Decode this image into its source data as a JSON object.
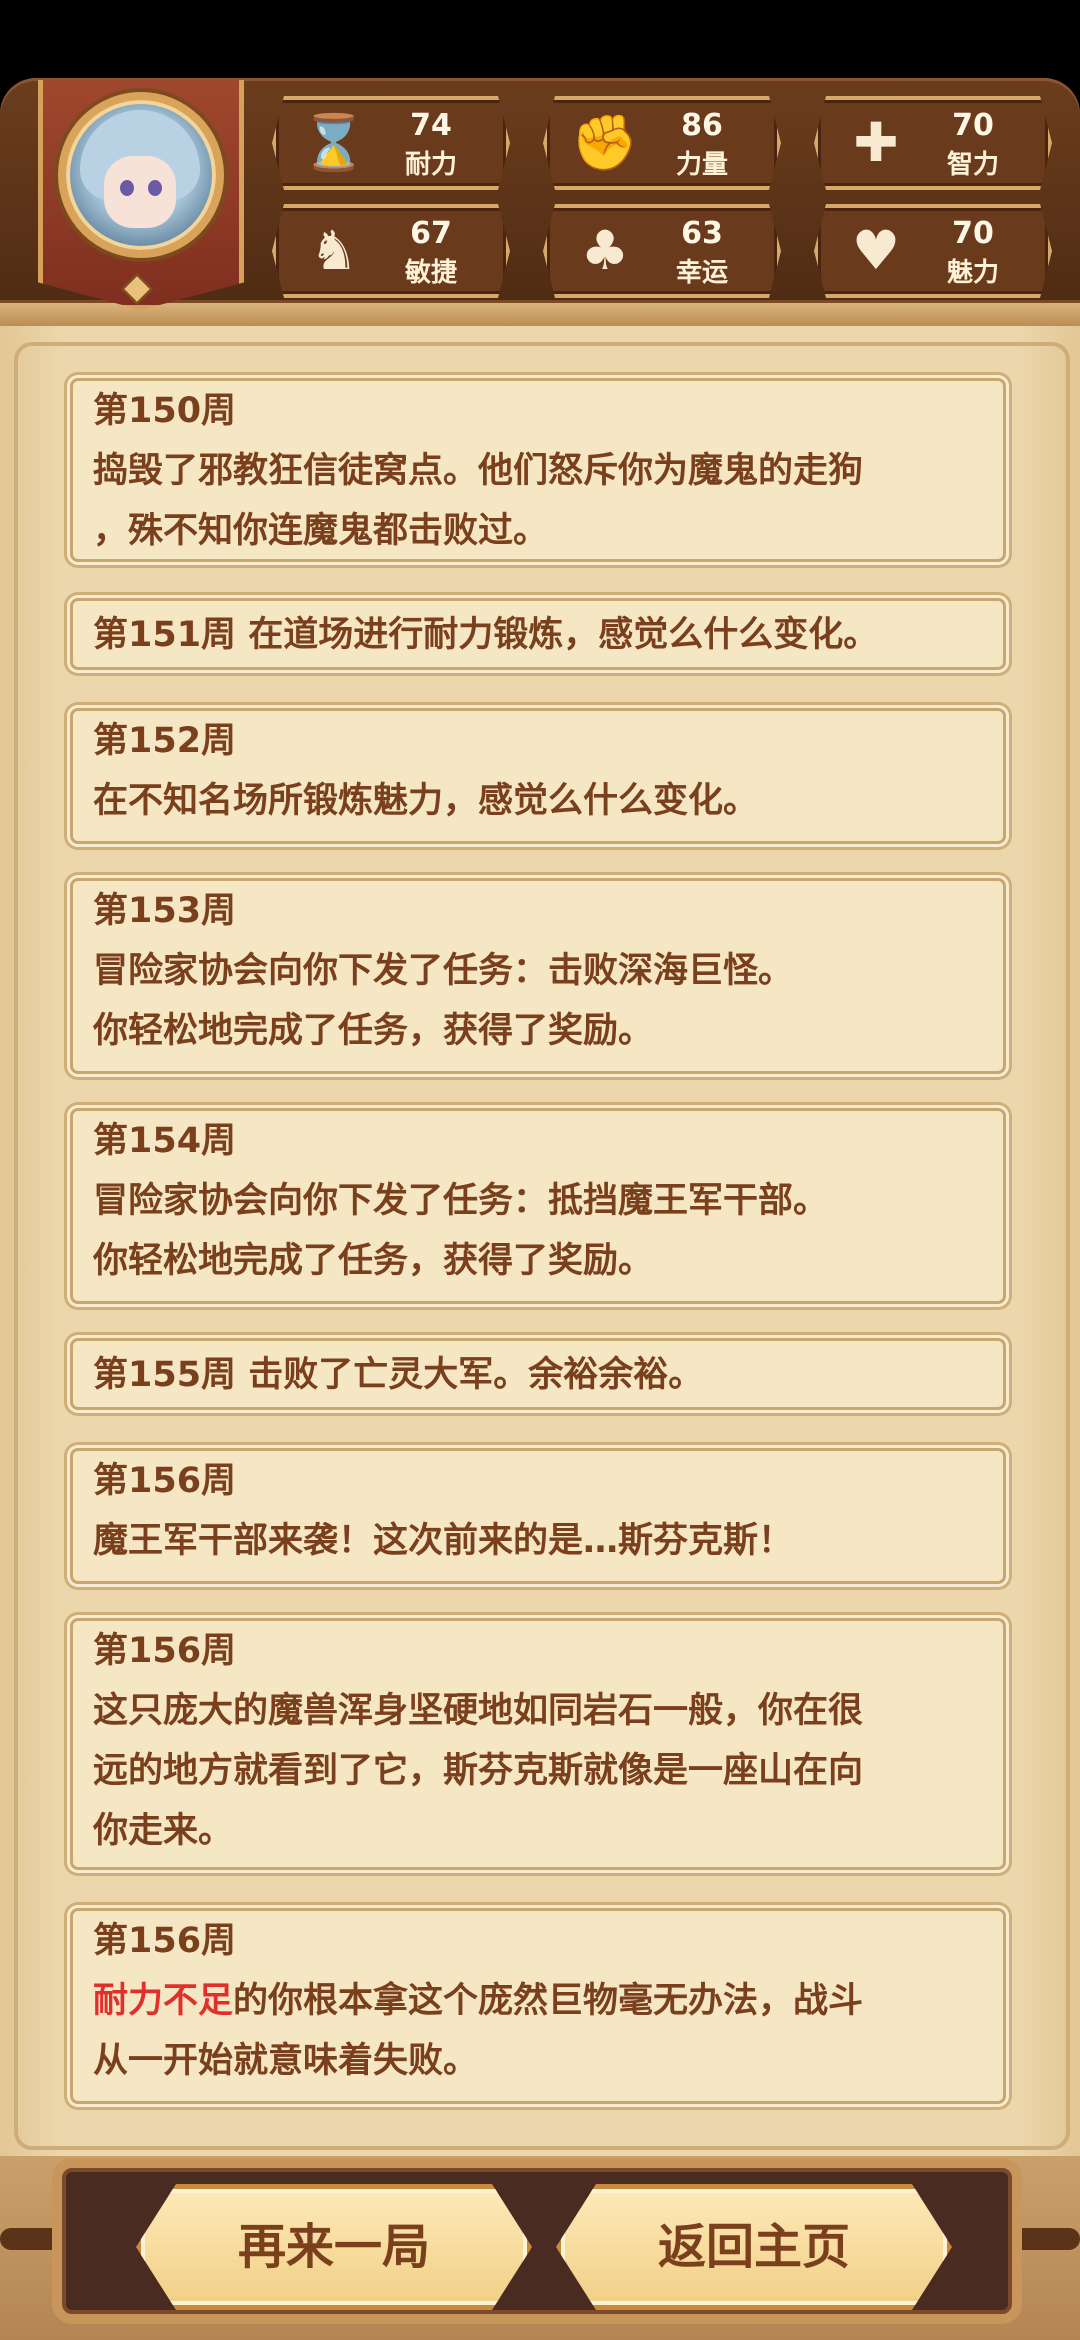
{
  "stats": [
    {
      "icon": "hourglass-icon",
      "value": "74",
      "label": "耐力"
    },
    {
      "icon": "strength-arm-icon",
      "value": "86",
      "label": "力量"
    },
    {
      "icon": "puzzle-icon",
      "value": "70",
      "label": "智力"
    },
    {
      "icon": "boot-icon",
      "value": "67",
      "label": "敏捷"
    },
    {
      "icon": "clover-icon",
      "value": "63",
      "label": "幸运"
    },
    {
      "icon": "heart-plus-icon",
      "value": "70",
      "label": "魅力"
    }
  ],
  "log": [
    {
      "week": "第150周",
      "lines": [
        "捣毁了邪教狂信徒窝点。他们怒斥你为魔鬼的走狗",
        "，殊不知你连魔鬼都击败过。"
      ]
    },
    {
      "inline": "第151周 在道场进行耐力锻炼，感觉么什么变化。"
    },
    {
      "week": "第152周",
      "lines": [
        "在不知名场所锻炼魅力，感觉么什么变化。"
      ]
    },
    {
      "week": "第153周",
      "lines": [
        "冒险家协会向你下发了任务：击败深海巨怪。",
        "你轻松地完成了任务，获得了奖励。"
      ]
    },
    {
      "week": "第154周",
      "lines": [
        "冒险家协会向你下发了任务：抵挡魔王军干部。",
        "你轻松地完成了任务，获得了奖励。"
      ]
    },
    {
      "inline": "第155周 击败了亡灵大军。余裕余裕。"
    },
    {
      "week": "第156周",
      "lines": [
        "魔王军干部来袭！这次前来的是…斯芬克斯！"
      ]
    },
    {
      "week": "第156周",
      "lines": [
        "这只庞大的魔兽浑身坚硬地如同岩石一般，你在很",
        "远的地方就看到了它，斯芬克斯就像是一座山在向",
        "你走来。"
      ]
    },
    {
      "week": "第156周",
      "highlight": "耐力不足",
      "line1_rest": "的你根本拿这个庞然巨物毫无办法，战斗",
      "lines": [
        "从一开始就意味着失败。"
      ]
    }
  ],
  "buttons": {
    "restart": "再来一局",
    "home": "返回主页"
  },
  "colors": {
    "text": "#7a3f1c",
    "highlight": "#e0302c",
    "panel": "#6a3a1c"
  }
}
